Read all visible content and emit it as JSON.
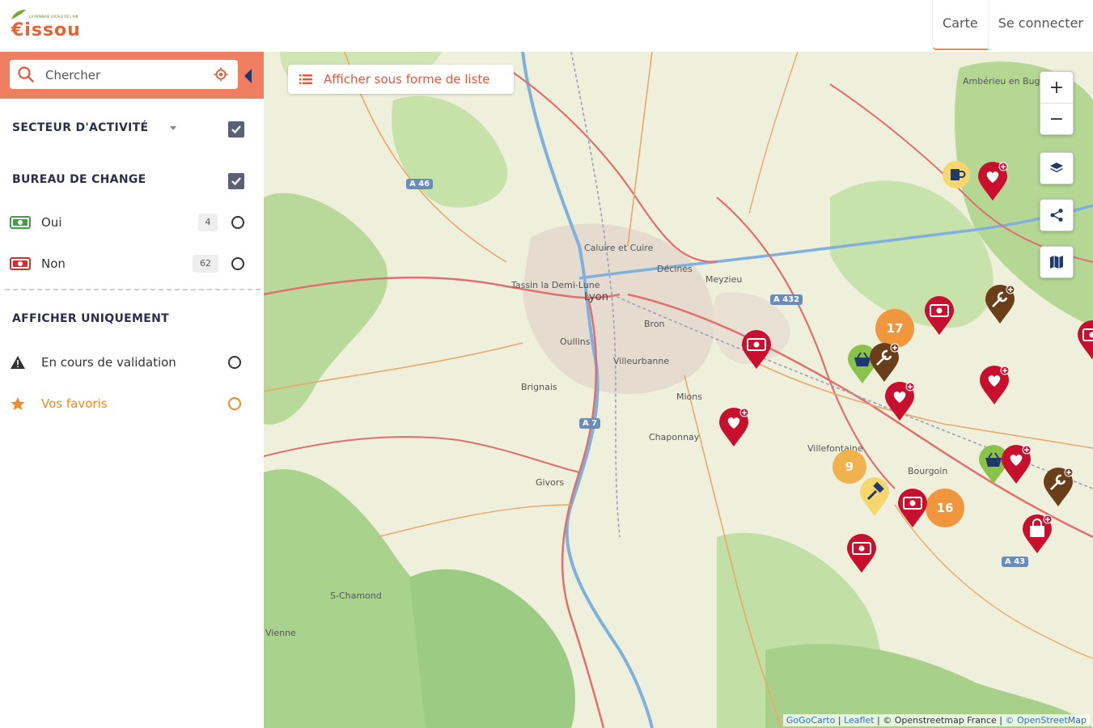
{
  "header": {
    "logo_text": "€issou",
    "logo_tagline": "LA MONNAIE LOCALE DE L'AIN",
    "nav": [
      {
        "label": "Carte",
        "active": true
      },
      {
        "label": "Se connecter",
        "active": false
      }
    ]
  },
  "sidebar": {
    "search_placeholder": "Chercher",
    "sector_title": "SECTEUR D'ACTIVITÉ",
    "exchange_title": "BUREAU DE CHANGE",
    "exchange_options": [
      {
        "label": "Oui",
        "count": "4",
        "icon_color": "#3fa142",
        "icon": "banknote-icon"
      },
      {
        "label": "Non",
        "count": "62",
        "icon_color": "#d32f2f",
        "icon": "banknote-icon"
      }
    ],
    "only_title": "AFFICHER UNIQUEMENT",
    "only_options": [
      {
        "label": "En cours de validation",
        "icon": "warning-icon"
      },
      {
        "label": "Vos favoris",
        "icon": "star-icon",
        "color": "#f08a24"
      }
    ]
  },
  "map": {
    "list_button_label": "Afficher sous forme de liste",
    "controls": [
      "zoom-in",
      "zoom-out",
      "layers",
      "share",
      "map-type"
    ],
    "zoom_in_label": "+",
    "zoom_out_label": "−",
    "clusters": [
      {
        "label": "17"
      },
      {
        "label": "9"
      },
      {
        "label": "16"
      }
    ],
    "place_labels": [
      "Lyon",
      "Villeurbanne",
      "Bron",
      "Meyzieu",
      "Givors",
      "Brignais",
      "Oullins",
      "Chaponnay",
      "Mions",
      "Tassin la Demi-Lune",
      "Caluire et Cuire",
      "Vienne",
      "Ambérieu en Bugey",
      "S-Chamond",
      "Bourgoin",
      "Villefontaine",
      "Décines"
    ],
    "road_shields": [
      "A 46",
      "A 432",
      "A 7",
      "A 43"
    ],
    "attribution": {
      "parts": [
        "GoGoCarto",
        "Leaflet",
        "© Openstreetmap France",
        "© OpenStreetMap"
      ]
    },
    "colors": {
      "accent": "#f07f62",
      "marker_red": "#c8102e",
      "marker_brown": "#6b3e1a",
      "marker_green": "#8bc34a",
      "marker_yellow": "#f5d76e",
      "cluster_orange": "#f0973d"
    }
  }
}
